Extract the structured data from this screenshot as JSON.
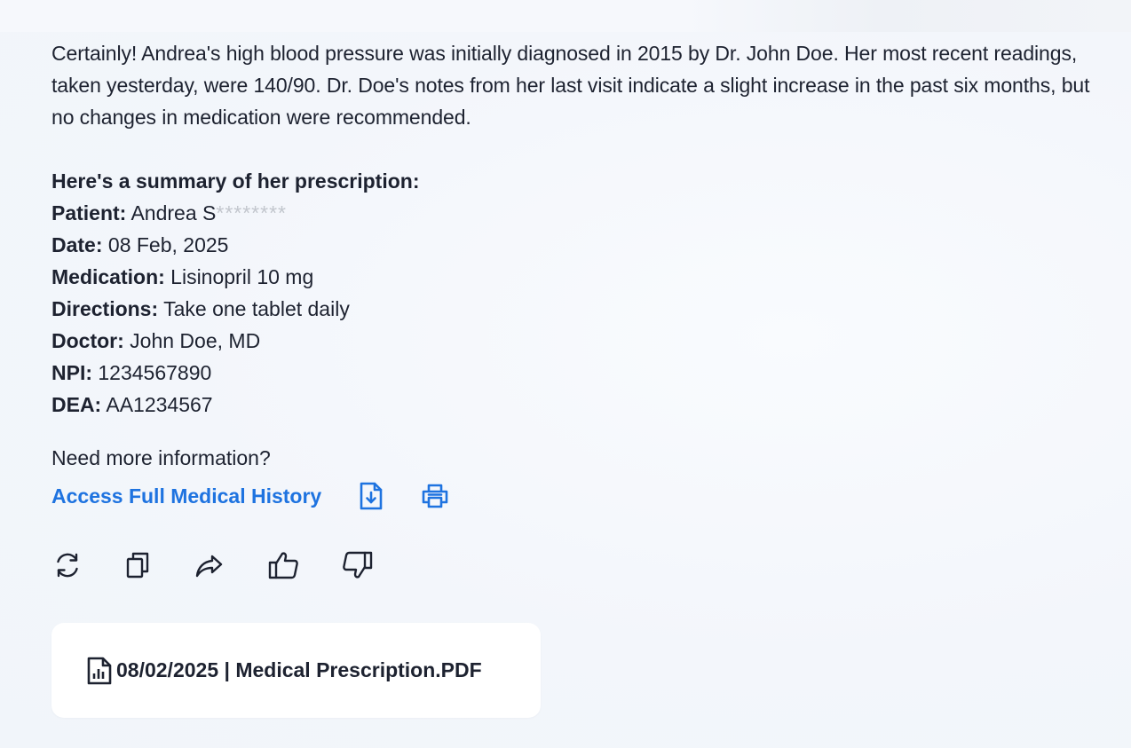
{
  "message": {
    "intro": "Certainly! Andrea's high blood pressure was initially diagnosed in 2015 by Dr. John Doe. Her most recent readings, taken yesterday, were 140/90. Dr. Doe's notes from her last visit indicate a slight increase in the past six months, but no changes in medication were recommended.",
    "summary_heading": "Here's a summary of her prescription:",
    "fields": [
      {
        "label": "Patient:",
        "value": "Andrea S",
        "masked": "********"
      },
      {
        "label": "Date:",
        "value": "08 Feb, 2025"
      },
      {
        "label": "Medication:",
        "value": "Lisinopril 10 mg"
      },
      {
        "label": "Directions:",
        "value": "Take one tablet daily"
      },
      {
        "label": "Doctor:",
        "value": "John Doe, MD"
      },
      {
        "label": "NPI:",
        "value": "1234567890"
      },
      {
        "label": "DEA:",
        "value": "AA1234567"
      }
    ],
    "need_more": "Need more information?",
    "access_link": "Access Full Medical History"
  },
  "icons": {
    "download": "file-download-icon",
    "print": "printer-icon",
    "regenerate": "refresh-icon",
    "copy": "copy-icon",
    "share": "share-icon",
    "like": "thumbs-up-icon",
    "dislike": "thumbs-down-icon",
    "file": "file-chart-icon"
  },
  "attachment": {
    "label": "08/02/2025 | Medical Prescription.PDF"
  },
  "colors": {
    "accent": "#1e73e0",
    "text": "#1d2230",
    "masked": "#c2c6cd",
    "card": "#ffffff"
  }
}
